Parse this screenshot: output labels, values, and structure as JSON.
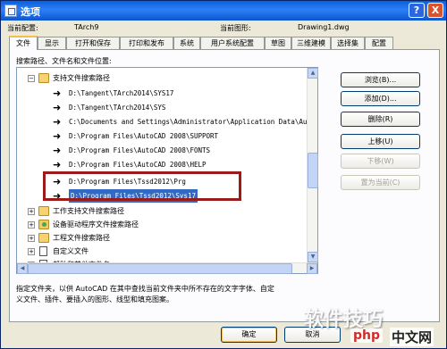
{
  "window": {
    "title": "选项",
    "help": "?",
    "close": "X"
  },
  "profile": {
    "current_config_label": "当前配置:",
    "current_config_value": "TArch9",
    "current_drawing_label": "当前图形:",
    "current_drawing_value": "Drawing1.dwg"
  },
  "tabs": [
    "文件",
    "显示",
    "打开和保存",
    "打印和发布",
    "系统",
    "用户系统配置",
    "草图",
    "三维建模",
    "选择集",
    "配置"
  ],
  "active_tab": "文件",
  "search": {
    "label": "搜索路径、文件名和文件位置:"
  },
  "tree": {
    "root": "支持文件搜索路径",
    "paths": [
      "D:\\Tangent\\TArch2014\\SYS17",
      "D:\\Tangent\\TArch2014\\SYS",
      "C:\\Documents and Settings\\Administrator\\Application Data\\Au",
      "D:\\Program Files\\AutoCAD 2008\\SUPPORT",
      "D:\\Program Files\\AutoCAD 2008\\FONTS",
      "D:\\Program Files\\AutoCAD 2008\\HELP",
      "D:\\Program Files\\Tssd2012\\Prg",
      "D:\\Program Files\\Tssd2012\\Sys17"
    ],
    "selected_index": 7,
    "nodes": [
      "工作支持文件搜索路径",
      "设备驱动程序文件搜索路径",
      "工程文件搜索路径",
      "自定义文件",
      "帮助和其他文件名"
    ]
  },
  "side_buttons": [
    {
      "label": "浏览(B)...",
      "enabled": true
    },
    {
      "label": "添加(D)...",
      "enabled": true
    },
    {
      "label": "删除(R)",
      "enabled": true
    },
    {
      "label": "上移(U)",
      "enabled": true
    },
    {
      "label": "下移(W)",
      "enabled": false
    },
    {
      "label": "置为当前(C)",
      "enabled": false
    }
  ],
  "description": {
    "line1": "指定文件夹，以供 AutoCAD 在其中查找当前文件夹中所不存在的文字字体、自定",
    "line2": "义文件、插件、要插入的图形、线型和填充图案。"
  },
  "bottom_buttons": {
    "ok": "确定",
    "cancel": "取消"
  },
  "watermark": {
    "text": "软件技巧",
    "logo": "php",
    "logo_cn": "中文网"
  },
  "colors": {
    "titlebar": "#0a5fdc",
    "selection": "#316ac5",
    "highlight_box": "#9b1b1b"
  }
}
